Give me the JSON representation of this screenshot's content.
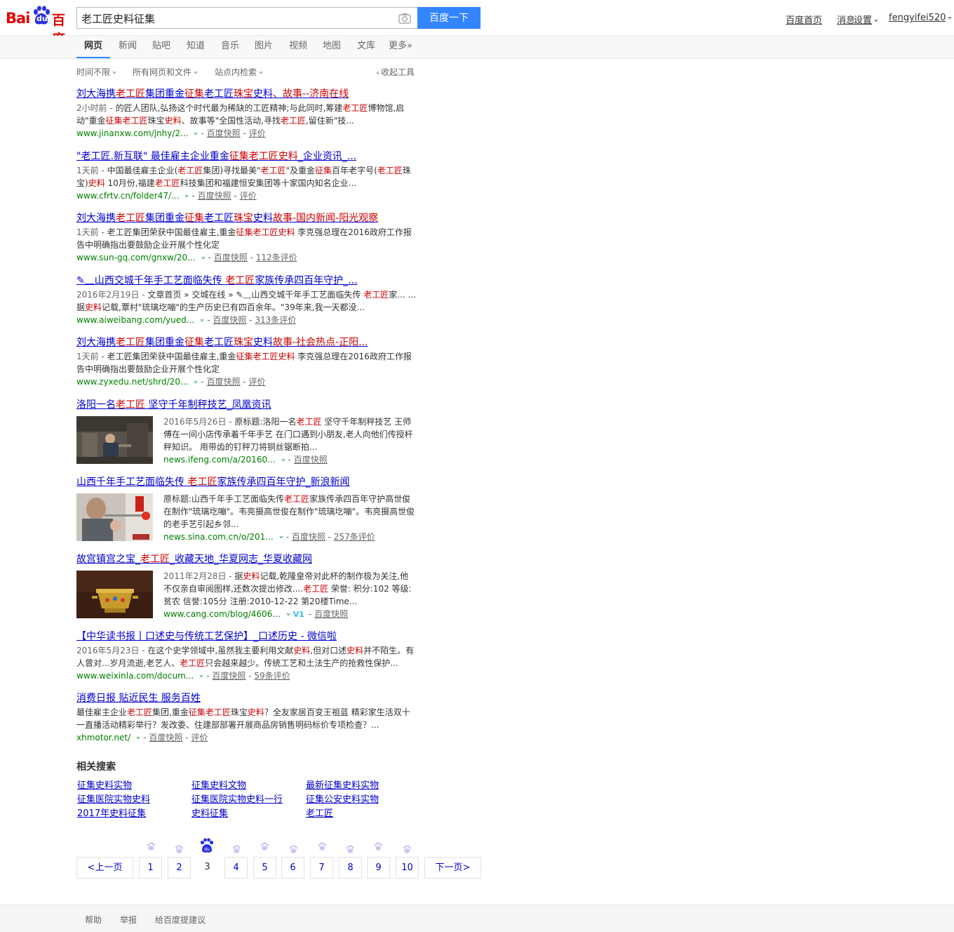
{
  "colors": {
    "accent": "#3385ff",
    "link": "#0000cc",
    "highlight": "#cc0000",
    "url": "#008000",
    "logo_red": "#e10601",
    "logo_blue": "#2932e1"
  },
  "logo": {
    "part1": "Bai",
    "part2": "du",
    "part3": "百度"
  },
  "search": {
    "value": "老工匠史料征集",
    "button": "百度一下",
    "camera_icon": "camera-icon"
  },
  "user_links": {
    "home": "百度首页",
    "messages": "消息",
    "settings": "设置",
    "username": "fengyifei520"
  },
  "tabs": [
    "网页",
    "新闻",
    "贴吧",
    "知道",
    "音乐",
    "图片",
    "视频",
    "地图",
    "文库",
    "更多»"
  ],
  "active_tab": "网页",
  "tools": {
    "time": "时间不限",
    "filetype": "所有网页和文件",
    "site": "站点内检索",
    "collapse": "收起工具"
  },
  "results": [
    {
      "title": [
        "刘大海携",
        "老工匠",
        "集团重金",
        "征集",
        "老工匠",
        "珠宝",
        "史料",
        "、故事--济南在线"
      ],
      "abstract": [
        {
          "t": "2小时前 - ",
          "c": "date"
        },
        {
          "t": "的匠人团队,弘扬这个时代最为稀缺的工匠精神;与此同时,筹建"
        },
        {
          "t": "老工匠",
          "c": "hl"
        },
        {
          "t": "博物馆,启动\"重金"
        },
        {
          "t": "征集老工匠",
          "c": "hl"
        },
        {
          "t": "珠宝"
        },
        {
          "t": "史料",
          "c": "hl"
        },
        {
          "t": "、故事等\"全国性活动,寻找"
        },
        {
          "t": "老工匠",
          "c": "hl"
        },
        {
          "t": ",留住新\"技..."
        }
      ],
      "url": "www.jinanxw.com/jnhy/2...",
      "snapshot": "百度快照",
      "review": "评价"
    },
    {
      "title": [
        "\"老工匠.新互联\" 最佳雇主企业重金",
        "征集老工匠史料",
        "_企业资讯_..."
      ],
      "abstract": [
        {
          "t": "1天前 - ",
          "c": "date"
        },
        {
          "t": "中国最佳雇主企业("
        },
        {
          "t": "老工匠",
          "c": "hl"
        },
        {
          "t": "集团)寻找最美\""
        },
        {
          "t": "老工匠",
          "c": "hl"
        },
        {
          "t": "\"及重金"
        },
        {
          "t": "征集",
          "c": "hl"
        },
        {
          "t": "百年老字号("
        },
        {
          "t": "老工匠",
          "c": "hl"
        },
        {
          "t": "珠宝)"
        },
        {
          "t": "史料",
          "c": "hl"
        },
        {
          "t": " 10月份,福建"
        },
        {
          "t": "老工匠",
          "c": "hl"
        },
        {
          "t": "科技集团和福建恒安集团等十家国内知名企业..."
        }
      ],
      "url": "www.cfrtv.cn/folder47/...",
      "snapshot": "百度快照",
      "review": "评价"
    },
    {
      "title": [
        "刘大海携",
        "老工匠",
        "集团重金",
        "征集",
        "老工匠",
        "珠宝",
        "史料",
        "故事-国内新闻-阳光观察"
      ],
      "abstract": [
        {
          "t": "1天前 - ",
          "c": "date"
        },
        {
          "t": "老工匠集团荣获中国最佳雇主,重金"
        },
        {
          "t": "征集",
          "c": "hl"
        },
        {
          "t": "老工匠史料",
          "c": "hl"
        },
        {
          "t": " 李克强总理在2016政府工作报告中明确指出要鼓励企业开展个性化定"
        }
      ],
      "url": "www.sun-gq.com/gnxw/20...",
      "snapshot": "百度快照",
      "review": "112条评价"
    },
    {
      "title": [
        "✎﹏山西交城千年手工艺面临失传 ",
        "老工匠",
        "家族传承四百年守护_..."
      ],
      "abstract": [
        {
          "t": "2016年2月19日 - ",
          "c": "date"
        },
        {
          "t": "文章首页 » 交城在线 » ✎﹏山西交城千年手工艺面临失传 "
        },
        {
          "t": "老工匠",
          "c": "hl"
        },
        {
          "t": "家... ...据"
        },
        {
          "t": "史料",
          "c": "hl"
        },
        {
          "t": "记载,覃村\"琉璃圪嘣\"的生产历史已有四百余年。\"39年来,我一天都没..."
        }
      ],
      "url": "www.aiweibang.com/yued...",
      "snapshot": "百度快照",
      "review": "313条评价"
    },
    {
      "title": [
        "刘大海携",
        "老工匠",
        "集团重金",
        "征集",
        "老工匠",
        "珠宝",
        "史料",
        "故事-社会热点-正阳..."
      ],
      "abstract": [
        {
          "t": "1天前 - ",
          "c": "date"
        },
        {
          "t": "老工匠集团荣获中国最佳雇主,重金"
        },
        {
          "t": "征集",
          "c": "hl"
        },
        {
          "t": "老工匠史料",
          "c": "hl"
        },
        {
          "t": " 李克强总理在2016政府工作报告中明确指出要鼓励企业开展个性化定"
        }
      ],
      "url": "www.zyxedu.net/shrd/20...",
      "snapshot": "百度快照",
      "review": "评价"
    }
  ],
  "image_results": [
    {
      "title": [
        "洛阳一名",
        "老工匠",
        " 坚守千年制秤技艺_凤凰资讯"
      ],
      "abstract": [
        {
          "t": "2016年5月26日 - ",
          "c": "date"
        },
        {
          "t": "原标题:洛阳一名"
        },
        {
          "t": "老工匠",
          "c": "hl"
        },
        {
          "t": " 坚守千年制秤技艺 王师傅在一间小店传承着千年手艺 在门口遇到小朋友,老人向他们传授杆秤知识。 用带齿的钉秤刀将铜丝锯断拍..."
        }
      ],
      "url": "news.ifeng.com/a/20160...",
      "snapshot": "百度快照",
      "review": ""
    },
    {
      "title": [
        "山西千年手工艺面临失传 ",
        "老工匠",
        "家族传承四百年守护_新浪新闻"
      ],
      "abstract": [
        {
          "t": "原标题:山西千年手工艺面临失传"
        },
        {
          "t": "老工匠",
          "c": "hl"
        },
        {
          "t": "家族传承四百年守护高世俊在制作\"琉璃圪嘣\"。韦亮摄高世俊在制作\"琉璃圪嘣\"。韦亮摄高世俊的老手艺引起乡邻..."
        }
      ],
      "url": "news.sina.com.cn/o/201...",
      "snapshot": "百度快照",
      "review": "257条评价"
    },
    {
      "title": [
        "故宫镇宫之宝_",
        "老工匠",
        "_收藏天地_华夏网志_华夏收藏网"
      ],
      "abstract": [
        {
          "t": "2011年2月28日 - ",
          "c": "date"
        },
        {
          "t": "据"
        },
        {
          "t": "史料",
          "c": "hl"
        },
        {
          "t": "记载,乾隆皇帝对此杯的制作极为关注,他不仅亲自审阅图样,还数次提出修改...."
        },
        {
          "t": "老工匠",
          "c": "hl"
        },
        {
          "t": " 荣誉: 积分:102 等级:贫农 信誉:105分 注册:2010-12-22 第20楼Time..."
        }
      ],
      "url": "www.cang.com/blog/4606...",
      "badge": "V1",
      "snapshot": "百度快照",
      "review": ""
    }
  ],
  "results_tail": [
    {
      "title": [
        "【中华读书报丨口述史与传统工艺保护】_口述历史 - 微信啦"
      ],
      "abstract": [
        {
          "t": "2016年5月23日 - ",
          "c": "date"
        },
        {
          "t": "在这个史学领域中,虽然我主要利用文献"
        },
        {
          "t": "史料",
          "c": "hl"
        },
        {
          "t": ",但对口述"
        },
        {
          "t": "史料",
          "c": "hl"
        },
        {
          "t": "并不陌生。有人曾对...岁月流逝,老艺人、"
        },
        {
          "t": "老工匠",
          "c": "hl"
        },
        {
          "t": "只会越来越少。传统工艺和土法生产的抢救性保护..."
        }
      ],
      "url": "www.weixinla.com/docum...",
      "snapshot": "百度快照",
      "review": "59条评价"
    },
    {
      "title": [
        "消费日报 贴近民生 服务百姓"
      ],
      "abstract": [
        {
          "t": "最佳雇主企业"
        },
        {
          "t": "老工匠",
          "c": "hl"
        },
        {
          "t": "集团,重金"
        },
        {
          "t": "征集老工匠",
          "c": "hl"
        },
        {
          "t": "珠宝"
        },
        {
          "t": "史料",
          "c": "hl"
        },
        {
          "t": "？全友家居百变王祖蓝 精彩家生活双十一直播活动精彩举行？发改委、住建部部署开展商品房销售明码标价专项检查？..."
        }
      ],
      "url": "xhmotor.net/",
      "snapshot": "百度快照",
      "review": "评价"
    }
  ],
  "related": {
    "title": "相关搜索",
    "items": [
      "征集史料实物",
      "征集史料文物",
      "最新征集史料实物",
      "征集医院实物史料",
      "征集医院实物史料一行",
      "征集公安史料实物",
      "2017年史料征集",
      "史料征集",
      "老工匠"
    ]
  },
  "pagination": {
    "prev": "<上一页",
    "pages": [
      "1",
      "2",
      "3",
      "4",
      "5",
      "6",
      "7",
      "8",
      "9",
      "10"
    ],
    "current": "3",
    "next": "下一页>"
  },
  "footer": {
    "help": "帮助",
    "report": "举报",
    "feedback": "给百度提建议"
  }
}
